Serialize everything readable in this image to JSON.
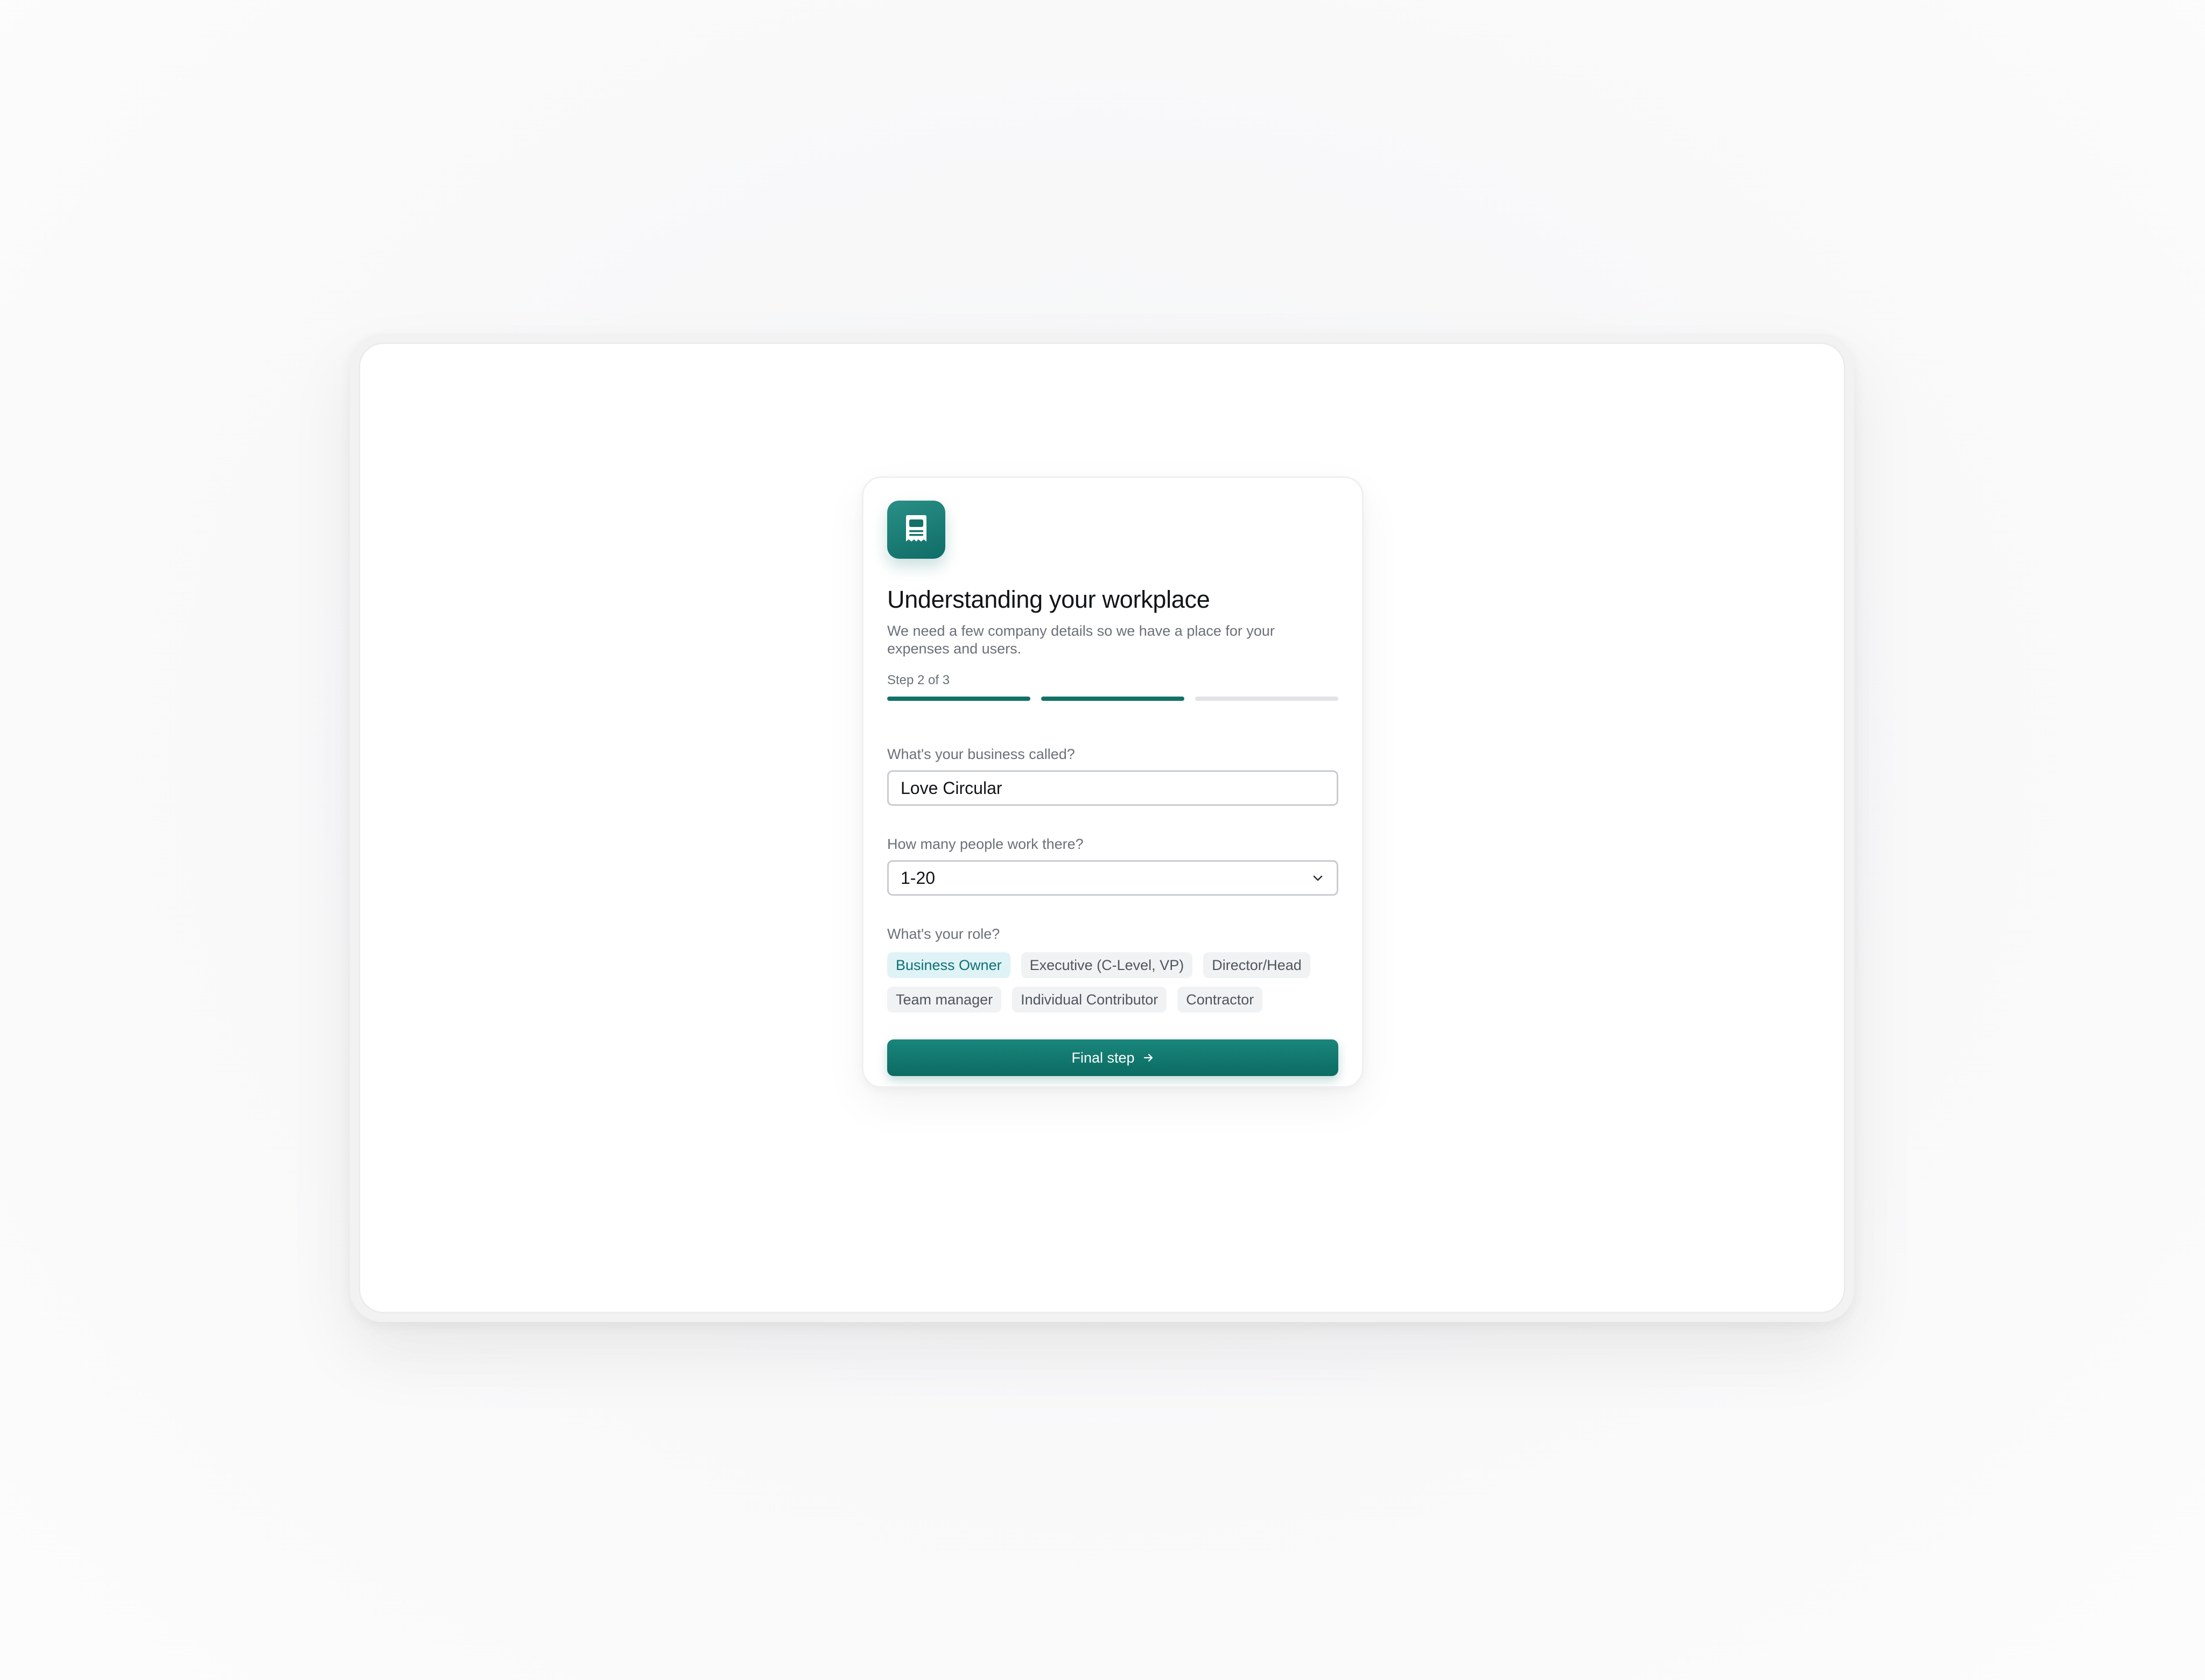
{
  "header": {
    "icon": "receipt-icon",
    "title": "Understanding your workplace",
    "subtitle": "We need a few company details so we have a place for your expenses and users."
  },
  "progress": {
    "label": "Step 2 of 3",
    "current_step": 2,
    "total_steps": 3
  },
  "form": {
    "business_name": {
      "label": "What's your business called?",
      "value": "Love Circular"
    },
    "company_size": {
      "label": "How many people work there?",
      "selected": "1-20",
      "icon": "chevron-down-icon"
    },
    "role": {
      "label": "What's your role?",
      "options": [
        "Business Owner",
        "Executive (C-Level, VP)",
        "Director/Head",
        "Team manager",
        "Individual Contributor",
        "Contractor"
      ],
      "selected": "Business Owner"
    }
  },
  "cta": {
    "label": "Final step",
    "icon": "arrow-right-icon"
  },
  "colors": {
    "brand": "#137268",
    "chip_selected_bg": "#dff3f7",
    "chip_selected_text": "#0e6f75",
    "progress_inactive": "#e1e3e6"
  }
}
